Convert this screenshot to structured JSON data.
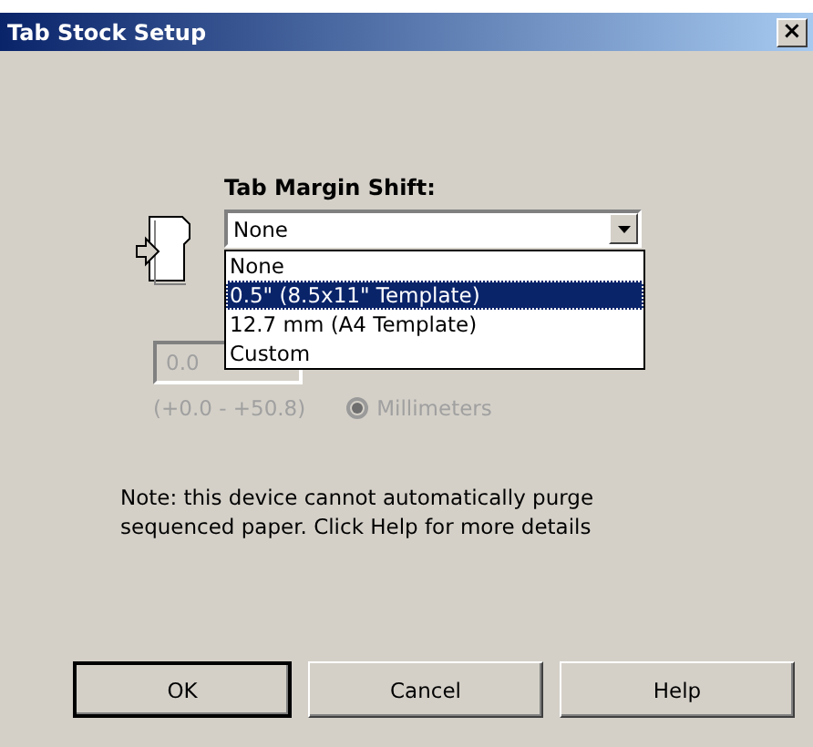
{
  "window": {
    "title": "Tab Stock Setup",
    "close": "×"
  },
  "margin_shift": {
    "label": "Tab Margin Shift:",
    "value": "None",
    "expanded": true,
    "options": [
      {
        "label": "None",
        "highlighted": false
      },
      {
        "label": "0.5\" (8.5x11\" Template)",
        "highlighted": true
      },
      {
        "label": "12.7 mm (A4 Template)",
        "highlighted": false
      },
      {
        "label": "Custom",
        "highlighted": false
      }
    ]
  },
  "custom_value": {
    "value": "0.0",
    "disabled": true
  },
  "range": {
    "text": "(+0.0 - +50.8)",
    "disabled": true
  },
  "units_radio": {
    "label": "Millimeters",
    "selected": true,
    "disabled": true
  },
  "note": "Note: this device cannot automatically purge sequenced paper.  Click Help for more details",
  "buttons": [
    "OK",
    "Cancel",
    "Help"
  ]
}
